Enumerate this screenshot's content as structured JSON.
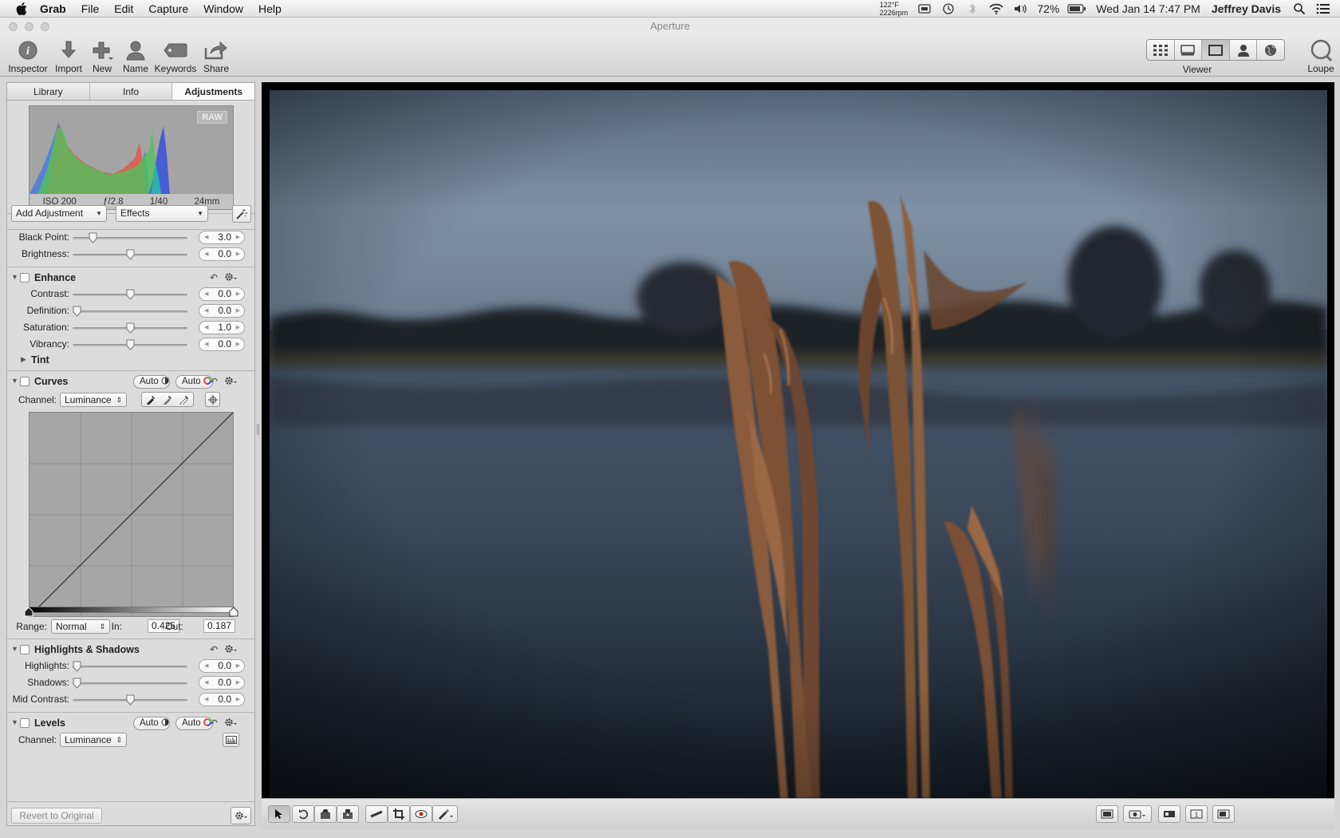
{
  "menubar": {
    "app": "Grab",
    "menus": [
      "File",
      "Edit",
      "Capture",
      "Window",
      "Help"
    ],
    "temp_line1": "122°F",
    "temp_line2": "2226rpm",
    "battery": "72%",
    "datetime": "Wed Jan 14  7:47 PM",
    "user": "Jeffrey Davis"
  },
  "window": {
    "title": "Aperture"
  },
  "toolbar": {
    "inspector": "Inspector",
    "import": "Import",
    "new": "New",
    "name": "Name",
    "keywords": "Keywords",
    "share": "Share",
    "viewer": "Viewer",
    "loupe": "Loupe"
  },
  "inspector": {
    "tabs": [
      "Library",
      "Info",
      "Adjustments"
    ],
    "active_tab": "Adjustments",
    "histogram": {
      "raw": "RAW",
      "iso": "ISO 200",
      "aperture": "ƒ/2.8",
      "shutter": "1/40",
      "focal": "24mm"
    },
    "add_adjustment": "Add Adjustment",
    "effects": "Effects",
    "exposure": {
      "black_point_label": "Black Point:",
      "black_point": "3.0",
      "black_point_level": 0.15,
      "brightness_label": "Brightness:",
      "brightness": "0.0",
      "brightness_level": 0.5
    },
    "enhance": {
      "title": "Enhance",
      "contrast_label": "Contrast:",
      "contrast": "0.0",
      "contrast_level": 0.5,
      "definition_label": "Definition:",
      "definition": "0.0",
      "definition_level": 0.0,
      "saturation_label": "Saturation:",
      "saturation": "1.0",
      "saturation_level": 0.5,
      "vibrancy_label": "Vibrancy:",
      "vibrancy": "0.0",
      "vibrancy_level": 0.5,
      "tint": "Tint"
    },
    "curves": {
      "title": "Curves",
      "auto1": "Auto",
      "auto2": "Auto",
      "channel_label": "Channel:",
      "channel": "Luminance",
      "range_label": "Range:",
      "range": "Normal",
      "in_label": "In:",
      "in": "0.425",
      "out_label": "Out:",
      "out": "0.187"
    },
    "highlights_shadows": {
      "title": "Highlights & Shadows",
      "highlights_label": "Highlights:",
      "highlights": "0.0",
      "highlights_level": 0.0,
      "shadows_label": "Shadows:",
      "shadows": "0.0",
      "shadows_level": 0.0,
      "mid_contrast_label": "Mid Contrast:",
      "mid_contrast": "0.0",
      "mid_contrast_level": 0.5
    },
    "levels": {
      "title": "Levels",
      "auto1": "Auto",
      "auto2": "Auto",
      "channel_label": "Channel:",
      "channel": "Luminance"
    },
    "revert": "Revert to Original"
  },
  "colors": {
    "accent": "#3b7fd9",
    "panel": "#dcdcdc",
    "viewer_bg": "#000000"
  }
}
